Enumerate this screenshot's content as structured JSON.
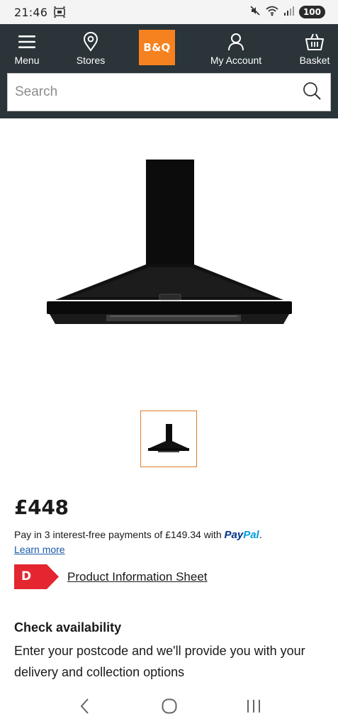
{
  "status_bar": {
    "time": "21:46",
    "battery": "100"
  },
  "header": {
    "menu_label": "Menu",
    "stores_label": "Stores",
    "logo_text": "B&Q",
    "account_label": "My Account",
    "basket_label": "Basket"
  },
  "search": {
    "placeholder": "Search"
  },
  "product": {
    "price": "£448",
    "paypal_text": "Pay in 3 interest-free payments of £149.34 with ",
    "paypal_logo_pay": "Pay",
    "paypal_logo_pal": "Pal",
    "paypal_suffix": ".",
    "learn_more": "Learn more",
    "energy_rating": "D",
    "pis_link": "Product Information Sheet"
  },
  "availability": {
    "title": "Check availability",
    "description": "Enter your postcode and we'll provide you with your delivery and collection options"
  },
  "colors": {
    "header_bg": "#2a3439",
    "brand_orange": "#f5821f",
    "energy_red": "#e3262f",
    "link_blue": "#1a5aa8"
  },
  "icons": {
    "menu": "hamburger-icon",
    "stores": "location-pin-icon",
    "account": "user-icon",
    "basket": "basket-icon",
    "search": "magnifier-icon"
  }
}
